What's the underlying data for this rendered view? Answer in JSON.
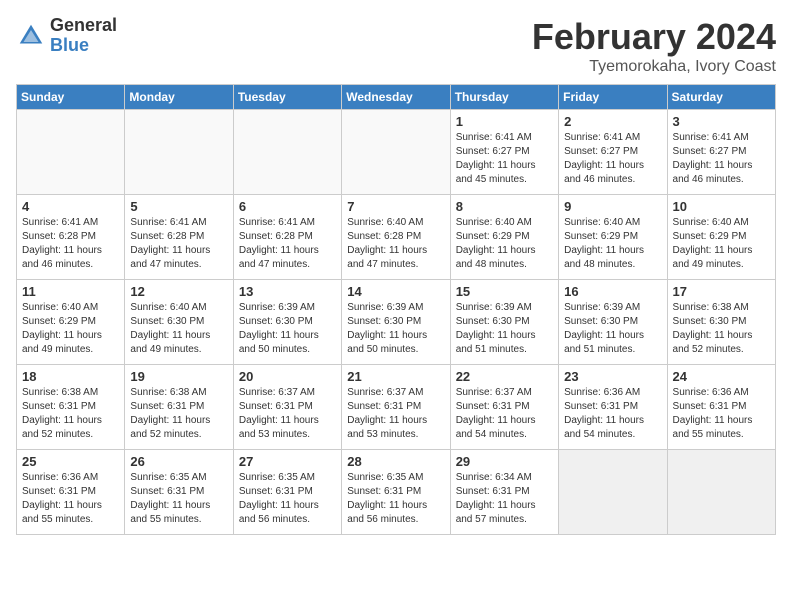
{
  "logo": {
    "general": "General",
    "blue": "Blue"
  },
  "title": "February 2024",
  "location": "Tyemorokaha, Ivory Coast",
  "days_of_week": [
    "Sunday",
    "Monday",
    "Tuesday",
    "Wednesday",
    "Thursday",
    "Friday",
    "Saturday"
  ],
  "weeks": [
    [
      {
        "day": "",
        "info": "",
        "empty": true
      },
      {
        "day": "",
        "info": "",
        "empty": true
      },
      {
        "day": "",
        "info": "",
        "empty": true
      },
      {
        "day": "",
        "info": "",
        "empty": true
      },
      {
        "day": "1",
        "info": "Sunrise: 6:41 AM\nSunset: 6:27 PM\nDaylight: 11 hours\nand 45 minutes."
      },
      {
        "day": "2",
        "info": "Sunrise: 6:41 AM\nSunset: 6:27 PM\nDaylight: 11 hours\nand 46 minutes."
      },
      {
        "day": "3",
        "info": "Sunrise: 6:41 AM\nSunset: 6:27 PM\nDaylight: 11 hours\nand 46 minutes."
      }
    ],
    [
      {
        "day": "4",
        "info": "Sunrise: 6:41 AM\nSunset: 6:28 PM\nDaylight: 11 hours\nand 46 minutes."
      },
      {
        "day": "5",
        "info": "Sunrise: 6:41 AM\nSunset: 6:28 PM\nDaylight: 11 hours\nand 47 minutes."
      },
      {
        "day": "6",
        "info": "Sunrise: 6:41 AM\nSunset: 6:28 PM\nDaylight: 11 hours\nand 47 minutes."
      },
      {
        "day": "7",
        "info": "Sunrise: 6:40 AM\nSunset: 6:28 PM\nDaylight: 11 hours\nand 47 minutes."
      },
      {
        "day": "8",
        "info": "Sunrise: 6:40 AM\nSunset: 6:29 PM\nDaylight: 11 hours\nand 48 minutes."
      },
      {
        "day": "9",
        "info": "Sunrise: 6:40 AM\nSunset: 6:29 PM\nDaylight: 11 hours\nand 48 minutes."
      },
      {
        "day": "10",
        "info": "Sunrise: 6:40 AM\nSunset: 6:29 PM\nDaylight: 11 hours\nand 49 minutes."
      }
    ],
    [
      {
        "day": "11",
        "info": "Sunrise: 6:40 AM\nSunset: 6:29 PM\nDaylight: 11 hours\nand 49 minutes."
      },
      {
        "day": "12",
        "info": "Sunrise: 6:40 AM\nSunset: 6:30 PM\nDaylight: 11 hours\nand 49 minutes."
      },
      {
        "day": "13",
        "info": "Sunrise: 6:39 AM\nSunset: 6:30 PM\nDaylight: 11 hours\nand 50 minutes."
      },
      {
        "day": "14",
        "info": "Sunrise: 6:39 AM\nSunset: 6:30 PM\nDaylight: 11 hours\nand 50 minutes."
      },
      {
        "day": "15",
        "info": "Sunrise: 6:39 AM\nSunset: 6:30 PM\nDaylight: 11 hours\nand 51 minutes."
      },
      {
        "day": "16",
        "info": "Sunrise: 6:39 AM\nSunset: 6:30 PM\nDaylight: 11 hours\nand 51 minutes."
      },
      {
        "day": "17",
        "info": "Sunrise: 6:38 AM\nSunset: 6:30 PM\nDaylight: 11 hours\nand 52 minutes."
      }
    ],
    [
      {
        "day": "18",
        "info": "Sunrise: 6:38 AM\nSunset: 6:31 PM\nDaylight: 11 hours\nand 52 minutes."
      },
      {
        "day": "19",
        "info": "Sunrise: 6:38 AM\nSunset: 6:31 PM\nDaylight: 11 hours\nand 52 minutes."
      },
      {
        "day": "20",
        "info": "Sunrise: 6:37 AM\nSunset: 6:31 PM\nDaylight: 11 hours\nand 53 minutes."
      },
      {
        "day": "21",
        "info": "Sunrise: 6:37 AM\nSunset: 6:31 PM\nDaylight: 11 hours\nand 53 minutes."
      },
      {
        "day": "22",
        "info": "Sunrise: 6:37 AM\nSunset: 6:31 PM\nDaylight: 11 hours\nand 54 minutes."
      },
      {
        "day": "23",
        "info": "Sunrise: 6:36 AM\nSunset: 6:31 PM\nDaylight: 11 hours\nand 54 minutes."
      },
      {
        "day": "24",
        "info": "Sunrise: 6:36 AM\nSunset: 6:31 PM\nDaylight: 11 hours\nand 55 minutes."
      }
    ],
    [
      {
        "day": "25",
        "info": "Sunrise: 6:36 AM\nSunset: 6:31 PM\nDaylight: 11 hours\nand 55 minutes."
      },
      {
        "day": "26",
        "info": "Sunrise: 6:35 AM\nSunset: 6:31 PM\nDaylight: 11 hours\nand 55 minutes."
      },
      {
        "day": "27",
        "info": "Sunrise: 6:35 AM\nSunset: 6:31 PM\nDaylight: 11 hours\nand 56 minutes."
      },
      {
        "day": "28",
        "info": "Sunrise: 6:35 AM\nSunset: 6:31 PM\nDaylight: 11 hours\nand 56 minutes."
      },
      {
        "day": "29",
        "info": "Sunrise: 6:34 AM\nSunset: 6:31 PM\nDaylight: 11 hours\nand 57 minutes."
      },
      {
        "day": "",
        "info": "",
        "empty": true,
        "shaded": true
      },
      {
        "day": "",
        "info": "",
        "empty": true,
        "shaded": true
      }
    ]
  ]
}
